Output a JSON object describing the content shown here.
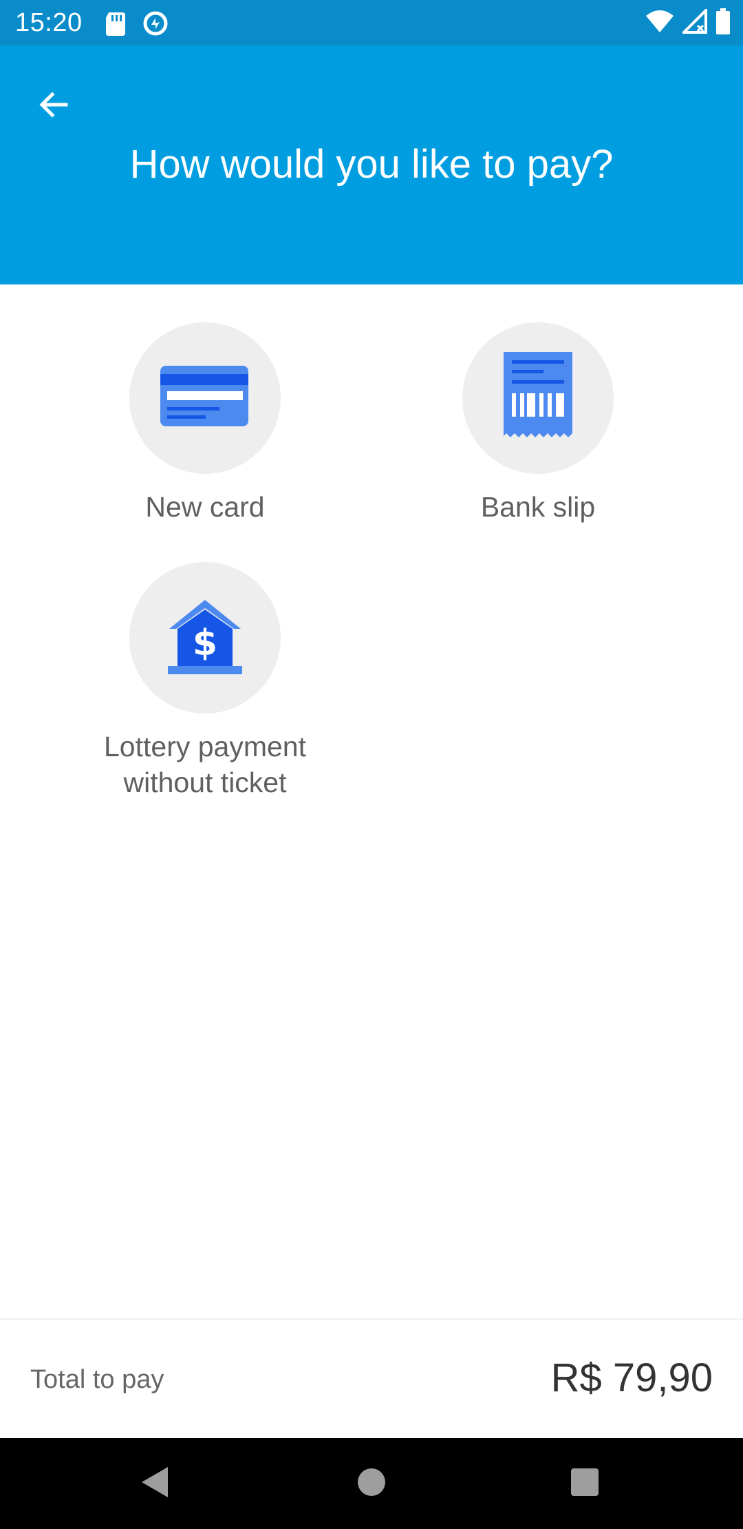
{
  "status_bar": {
    "time": "15:20",
    "icons": [
      "sd-card-icon",
      "data-saver-icon",
      "wifi-icon",
      "signal-icon",
      "battery-icon"
    ]
  },
  "header": {
    "title": "How would you like to pay?",
    "back_icon": "arrow-back-icon",
    "background_color": "#009ee0"
  },
  "payment_options": [
    {
      "label": "New card",
      "icon": "credit-card-icon"
    },
    {
      "label": "Bank slip",
      "icon": "bank-slip-icon"
    },
    {
      "label": "Lottery payment\nwithout ticket",
      "icon": "lottery-bank-icon"
    }
  ],
  "footer": {
    "total_label": "Total to pay",
    "total_value": "R$ 79,90"
  },
  "nav_bar": {
    "icons": [
      "nav-back-icon",
      "nav-home-icon",
      "nav-recents-icon"
    ]
  },
  "colors": {
    "accent_blue": "#3d7bf0",
    "accent_blue_dark": "#1556e6",
    "option_circle": "#eeeeee"
  }
}
